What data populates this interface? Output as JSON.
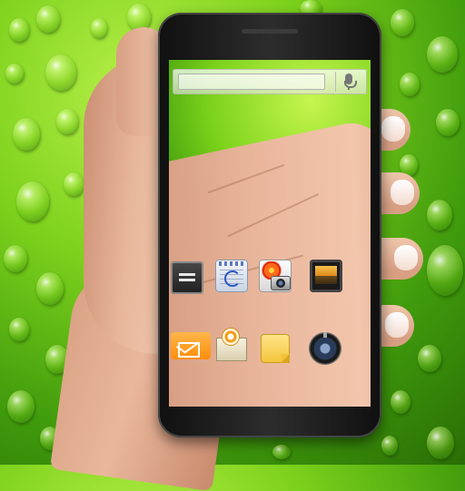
{
  "colors": {
    "background_green": "#7cd11c",
    "phone_bezel": "#1a1a1a",
    "messaging_orange": "#ff8e0d",
    "memo_yellow": "#f2c43a"
  },
  "search_bar": {
    "query": "",
    "voice_icon": "microphone-icon"
  },
  "home_screen": {
    "row1": [
      {
        "icon": "notes-icon"
      },
      {
        "icon": "calendar-icon"
      },
      {
        "icon": "camera-photo-icon"
      },
      {
        "icon": "gallery-icon"
      }
    ],
    "row2": [
      {
        "icon": "messaging-icon"
      },
      {
        "icon": "email-icon"
      },
      {
        "icon": "memo-icon"
      },
      {
        "icon": "settings-knob-icon"
      }
    ]
  }
}
